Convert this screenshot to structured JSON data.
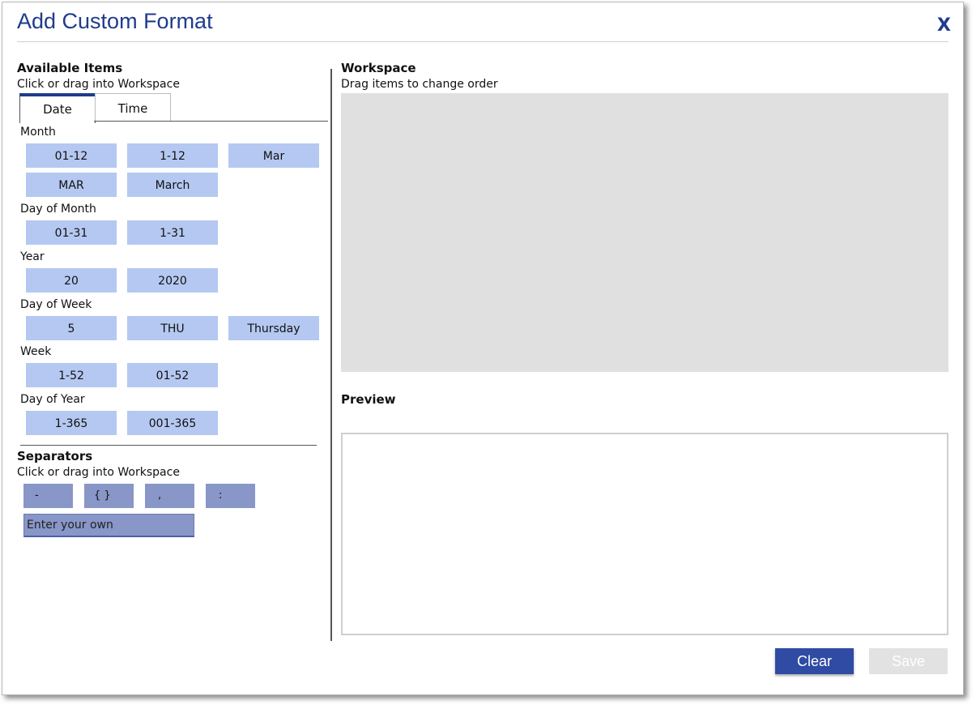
{
  "dialog": {
    "title": "Add Custom Format",
    "close_label": "X"
  },
  "available": {
    "heading": "Available Items",
    "hint": "Click or drag into Workspace",
    "tabs": [
      {
        "label": "Date",
        "active": true
      },
      {
        "label": "Time",
        "active": false
      }
    ],
    "groups": [
      {
        "label": "Month",
        "items": [
          "01-12",
          "1-12",
          "Mar",
          "MAR",
          "March"
        ]
      },
      {
        "label": "Day of Month",
        "items": [
          "01-31",
          "1-31"
        ]
      },
      {
        "label": "Year",
        "items": [
          "20",
          "2020"
        ]
      },
      {
        "label": "Day of Week",
        "items": [
          "5",
          "THU",
          "Thursday"
        ]
      },
      {
        "label": "Week",
        "items": [
          "1-52",
          "01-52"
        ]
      },
      {
        "label": "Day of Year",
        "items": [
          "1-365",
          "001-365"
        ]
      }
    ]
  },
  "separators": {
    "heading": "Separators",
    "hint": "Click or drag into Workspace",
    "items": [
      "-",
      "{ }",
      ",",
      ":"
    ],
    "own_placeholder": "Enter your own"
  },
  "workspace": {
    "heading": "Workspace",
    "hint": "Drag items to change order"
  },
  "preview": {
    "heading": "Preview",
    "value": ""
  },
  "buttons": {
    "clear_label": "Clear",
    "save_label": "Save",
    "save_enabled": false
  },
  "colors": {
    "accent": "#1f3b8c",
    "item_chip": "#b4c8f1",
    "separator_chip": "#8896c8",
    "workspace_bg": "#e0e0e0",
    "clear_button": "#2f4ba3",
    "save_button_disabled": "#e2e2e2"
  }
}
